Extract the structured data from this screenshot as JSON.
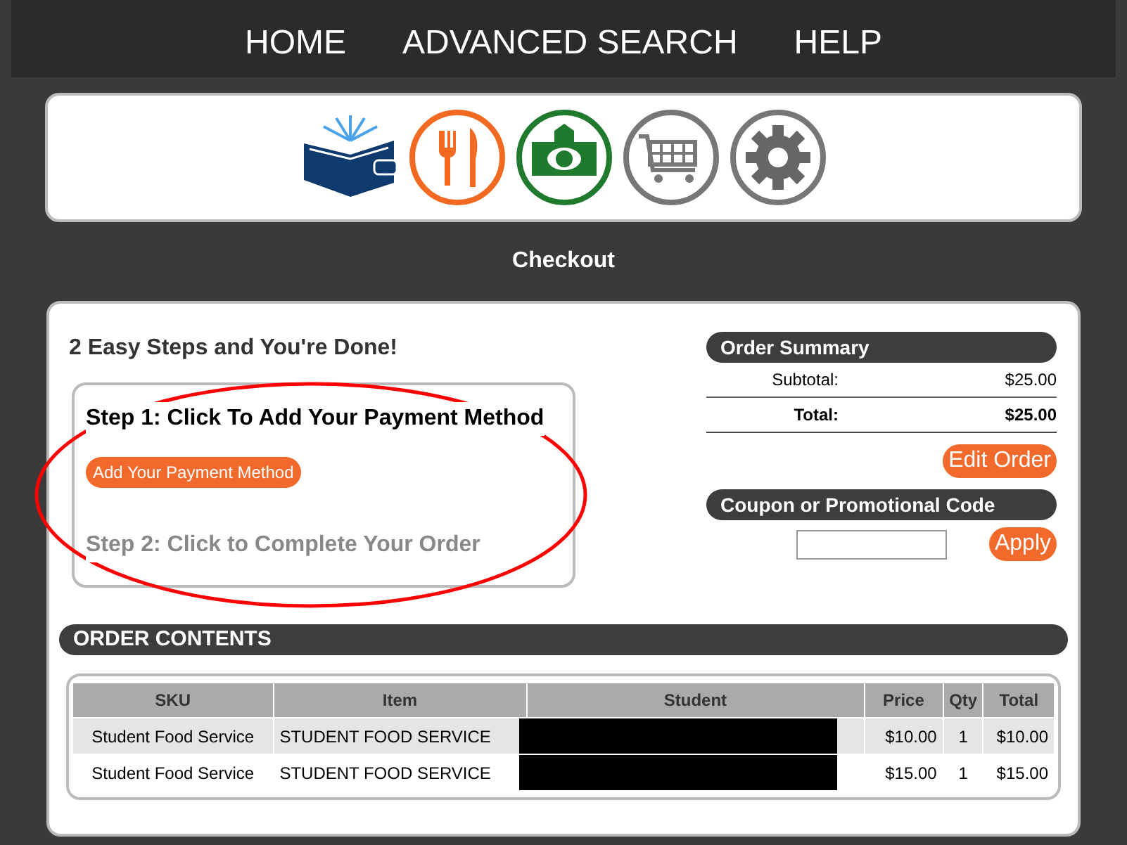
{
  "nav": [
    {
      "label": "HOME"
    },
    {
      "label": "ADVANCED SEARCH"
    },
    {
      "label": "HELP"
    }
  ],
  "icons": [
    {
      "kind": "wallet"
    },
    {
      "kind": "dining"
    },
    {
      "kind": "money"
    },
    {
      "kind": "cart"
    },
    {
      "kind": "settings"
    }
  ],
  "page_title": "Checkout",
  "steps_heading": "2 Easy Steps and You're Done!",
  "steps": [
    {
      "title": "Step 1: Click To Add Your Payment Method",
      "button": "Add Your Payment Method",
      "disabled": false
    },
    {
      "title": "Step 2: Click to Complete Your Order",
      "disabled": true
    }
  ],
  "annotation": {
    "kind": "ellipse",
    "color": "#ff0000"
  },
  "order_summary": {
    "title": "Order Summary",
    "rows": [
      {
        "label": "Subtotal:",
        "value": "$25.00",
        "bold": false
      },
      {
        "label": "Total:",
        "value": "$25.00",
        "bold": true
      }
    ],
    "edit_button": "Edit Order"
  },
  "coupon": {
    "title": "Coupon or Promotional Code",
    "button": "Apply"
  },
  "order_contents": {
    "title": "ORDER CONTENTS",
    "columns": [
      "SKU",
      "Item",
      "Student",
      "Price",
      "Qty",
      "Total"
    ],
    "rows": [
      {
        "sku": "Student Food Service",
        "item": "STUDENT FOOD SERVICE",
        "redacted": true,
        "price": "$10.00",
        "qty": "1",
        "total": "$10.00"
      },
      {
        "sku": "Student Food Service",
        "item": "STUDENT FOOD SERVICE",
        "redacted": true,
        "price": "$15.00",
        "qty": "1",
        "total": "$15.00"
      }
    ]
  }
}
